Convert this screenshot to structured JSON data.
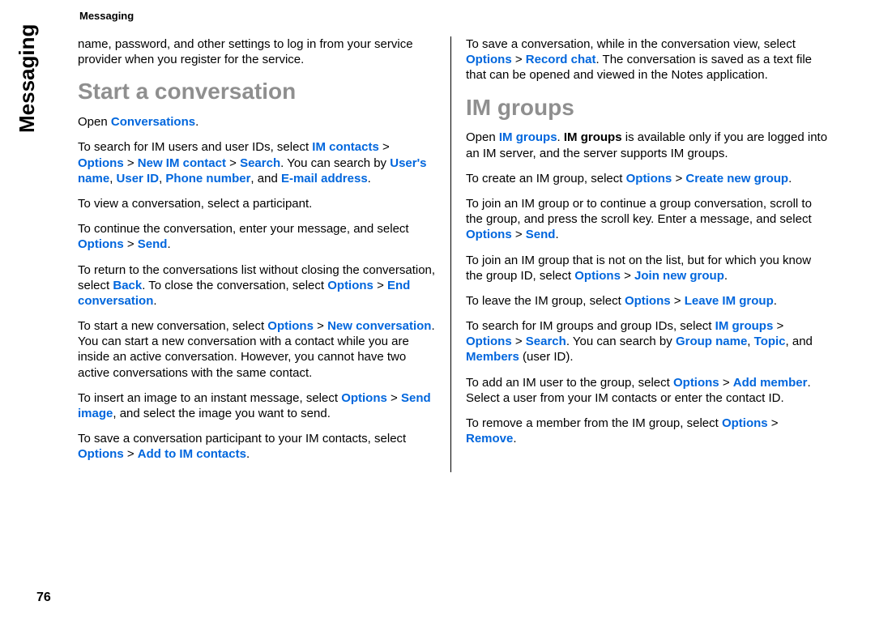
{
  "header": "Messaging",
  "sideTab": "Messaging",
  "pageNumber": "76",
  "left": {
    "intro": "name, password, and other settings to log in from your service provider when you register for the service.",
    "h2": "Start a conversation",
    "open_pre": "Open ",
    "open_link": "Conversations",
    "open_post": ".",
    "p2_a": "To search for IM users and user IDs, select ",
    "p2_b": "IM contacts",
    "p2_c": " > ",
    "p2_d": "Options",
    "p2_e": " > ",
    "p2_f": "New IM contact",
    "p2_g": " > ",
    "p2_h": "Search",
    "p2_i": ". You can search by ",
    "p2_j": "User's name",
    "p2_k": ", ",
    "p2_l": "User ID",
    "p2_m": ", ",
    "p2_n": "Phone number",
    "p2_o": ", and ",
    "p2_p": "E-mail address",
    "p2_q": ".",
    "p3": "To view a conversation, select a participant.",
    "p4_a": "To continue the conversation, enter your message, and select ",
    "p4_b": "Options",
    "p4_c": " > ",
    "p4_d": "Send",
    "p4_e": ".",
    "p5_a": "To return to the conversations list without closing the conversation, select ",
    "p5_b": "Back",
    "p5_c": ". To close the conversation, select ",
    "p5_d": "Options",
    "p5_e": " > ",
    "p5_f": "End conversation",
    "p5_g": ".",
    "p6_a": "To start a new conversation, select ",
    "p6_b": "Options",
    "p6_c": " > ",
    "p6_d": "New conversation",
    "p6_e": ". You can start a new conversation with a contact while you are inside an active conversation. However, you cannot have two active conversations with the same contact.",
    "p7_a": "To insert an image to an instant message, select ",
    "p7_b": "Options",
    "p7_c": " > ",
    "p7_d": "Send image",
    "p7_e": ", and select the image you want to send.",
    "p8_a": "To save a conversation participant to your IM contacts, select ",
    "p8_b": "Options",
    "p8_c": " > ",
    "p8_d": "Add to IM contacts",
    "p8_e": "."
  },
  "right": {
    "p1_a": "To save a conversation, while in the conversation view, select ",
    "p1_b": "Options",
    "p1_c": " > ",
    "p1_d": "Record chat",
    "p1_e": ". The conversation is saved as a text file that can be opened and viewed in the Notes application.",
    "h2": "IM groups",
    "p2_a": "Open ",
    "p2_b": "IM groups",
    "p2_c": ". ",
    "p2_d": "IM groups",
    "p2_e": " is available only if you are logged into an IM server, and the server supports IM groups.",
    "p3_a": "To create an IM group, select ",
    "p3_b": "Options",
    "p3_c": " > ",
    "p3_d": "Create new group",
    "p3_e": ".",
    "p4_a": "To join an IM group or to continue a group conversation, scroll to the group, and press the scroll key. Enter a message, and select ",
    "p4_b": "Options",
    "p4_c": " > ",
    "p4_d": "Send",
    "p4_e": ".",
    "p5_a": "To join an IM group that is not on the list, but for which you know the group ID, select ",
    "p5_b": "Options",
    "p5_c": " > ",
    "p5_d": "Join new group",
    "p5_e": ".",
    "p6_a": "To leave the IM group, select ",
    "p6_b": "Options",
    "p6_c": " > ",
    "p6_d": "Leave IM group",
    "p6_e": ".",
    "p7_a": "To search for IM groups and group IDs, select ",
    "p7_b": "IM groups",
    "p7_c": " > ",
    "p7_d": "Options",
    "p7_e": " > ",
    "p7_f": "Search",
    "p7_g": ". You can search by ",
    "p7_h": "Group name",
    "p7_i": ", ",
    "p7_j": "Topic",
    "p7_k": ", and ",
    "p7_l": "Members",
    "p7_m": " (user ID).",
    "p8_a": "To add an IM user to the group, select ",
    "p8_b": "Options",
    "p8_c": " > ",
    "p8_d": "Add member",
    "p8_e": ". Select a user from your IM contacts or enter the contact ID.",
    "p9_a": "To remove a member from the IM group, select ",
    "p9_b": "Options",
    "p9_c": " > ",
    "p9_d": "Remove",
    "p9_e": "."
  }
}
